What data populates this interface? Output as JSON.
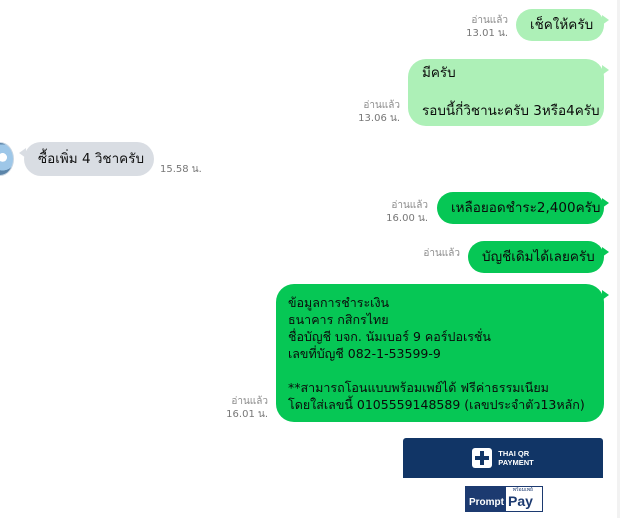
{
  "messages": [
    {
      "text": "เช็คให้ครับ",
      "read": "อ่านแล้ว",
      "time": "13.01 น."
    },
    {
      "text": "มีครับ\n\nรอบนี้กี่วิชานะครับ 3หรือ4ครับ",
      "read": "อ่านแล้ว",
      "time": "13.06 น."
    },
    {
      "text": "ซื้อเพิ่ม 4 วิชาครับ",
      "time": "15.58 น."
    },
    {
      "text": "เหลือยอดชำระ2,400ครับ",
      "read": "อ่านแล้ว",
      "time": "16.00 น."
    },
    {
      "text": "บัญชีเดิมได้เลยครับ",
      "read": "อ่านแล้ว"
    },
    {
      "text": "ข้อมูลการชำระเงิน\nธนาคาร กสิกรไทย\nชื่อบัญชี บจก. นัมเบอร์ 9 คอร์ปอเรชั่น\nเลขที่บัญชี 082-1-53599-9\n\n**สามารถโอนแบบพร้อมเพย์ได้ ฟรีค่าธรรมเนียม\nโดยใส่เลขนี้ 0105559148589 (เลขประจำตัว13หลัก)",
      "read": "อ่านแล้ว",
      "time": "16.01 น."
    }
  ],
  "qr_card": {
    "band_line1": "THAI QR",
    "band_line2": "PAYMENT",
    "promptpay_left": "Prompt",
    "promptpay_right": "Pay",
    "promptpay_thai": "พร้อมเพย์"
  },
  "colors": {
    "bubble_light": "#adf0b7",
    "bubble_green": "#06c755",
    "bubble_gray": "#d9dde3",
    "qr_band": "#113566"
  }
}
